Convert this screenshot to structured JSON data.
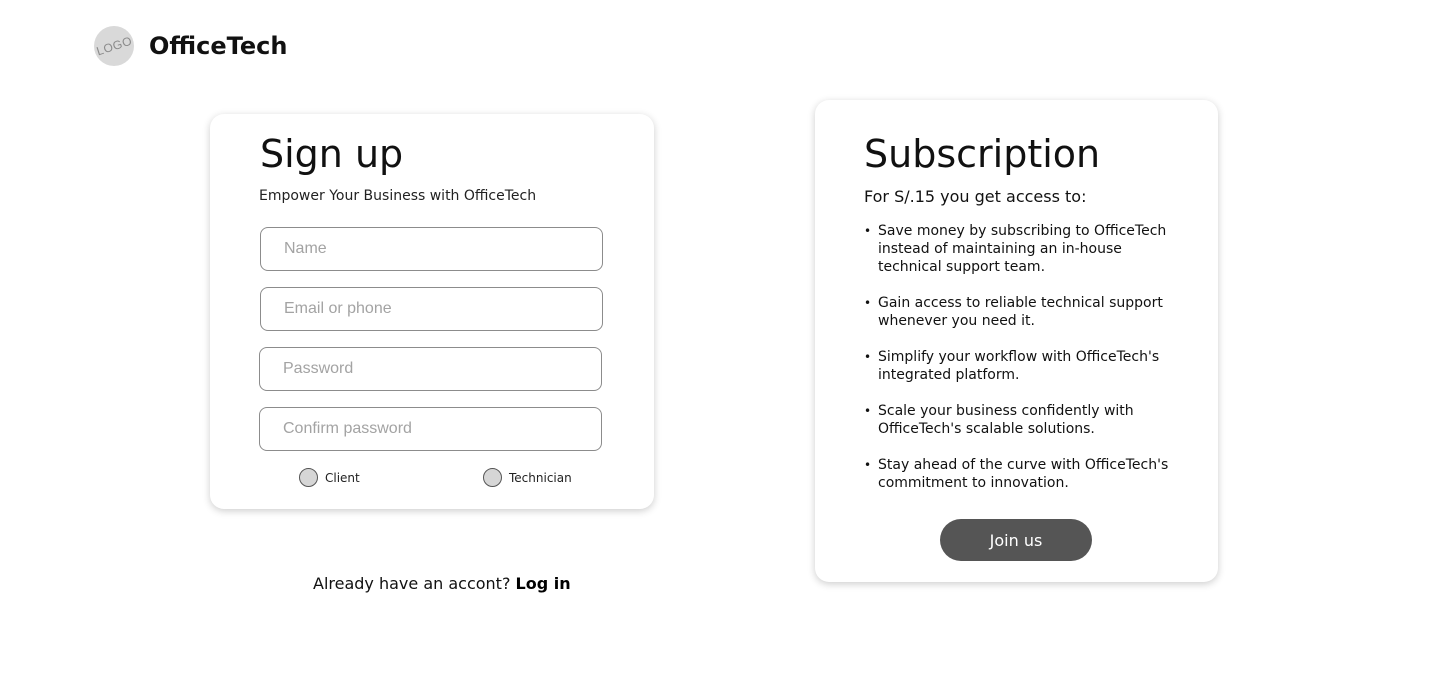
{
  "header": {
    "logo_text": "LOGO",
    "brand": "OfficeTech"
  },
  "signup": {
    "title": "Sign up",
    "subtitle": "Empower Your Business with OfficeTech",
    "fields": {
      "name_placeholder": "Name",
      "email_placeholder": "Email or phone",
      "password_placeholder": "Password",
      "confirm_placeholder": "Confirm password"
    },
    "roles": {
      "client": "Client",
      "technician": "Technician"
    },
    "login_prompt": "Already have an accont?",
    "login_link": "Log in"
  },
  "subscription": {
    "title": "Subscription",
    "lead": "For S/.15 you get access to:",
    "benefits": [
      "Save money by subscribing to OfficeTech instead of maintaining an in-house technical support team.",
      "Gain access to reliable technical support whenever you need it.",
      "Simplify your workflow with OfficeTech's integrated platform.",
      " Scale your business confidently with OfficeTech's scalable solutions.",
      "Stay ahead of the curve with OfficeTech's commitment to innovation."
    ],
    "cta": "Join us"
  },
  "colors": {
    "button_bg": "#555555",
    "radio_fill": "#d6d6d6",
    "logo_bg": "#d9d9d9"
  }
}
